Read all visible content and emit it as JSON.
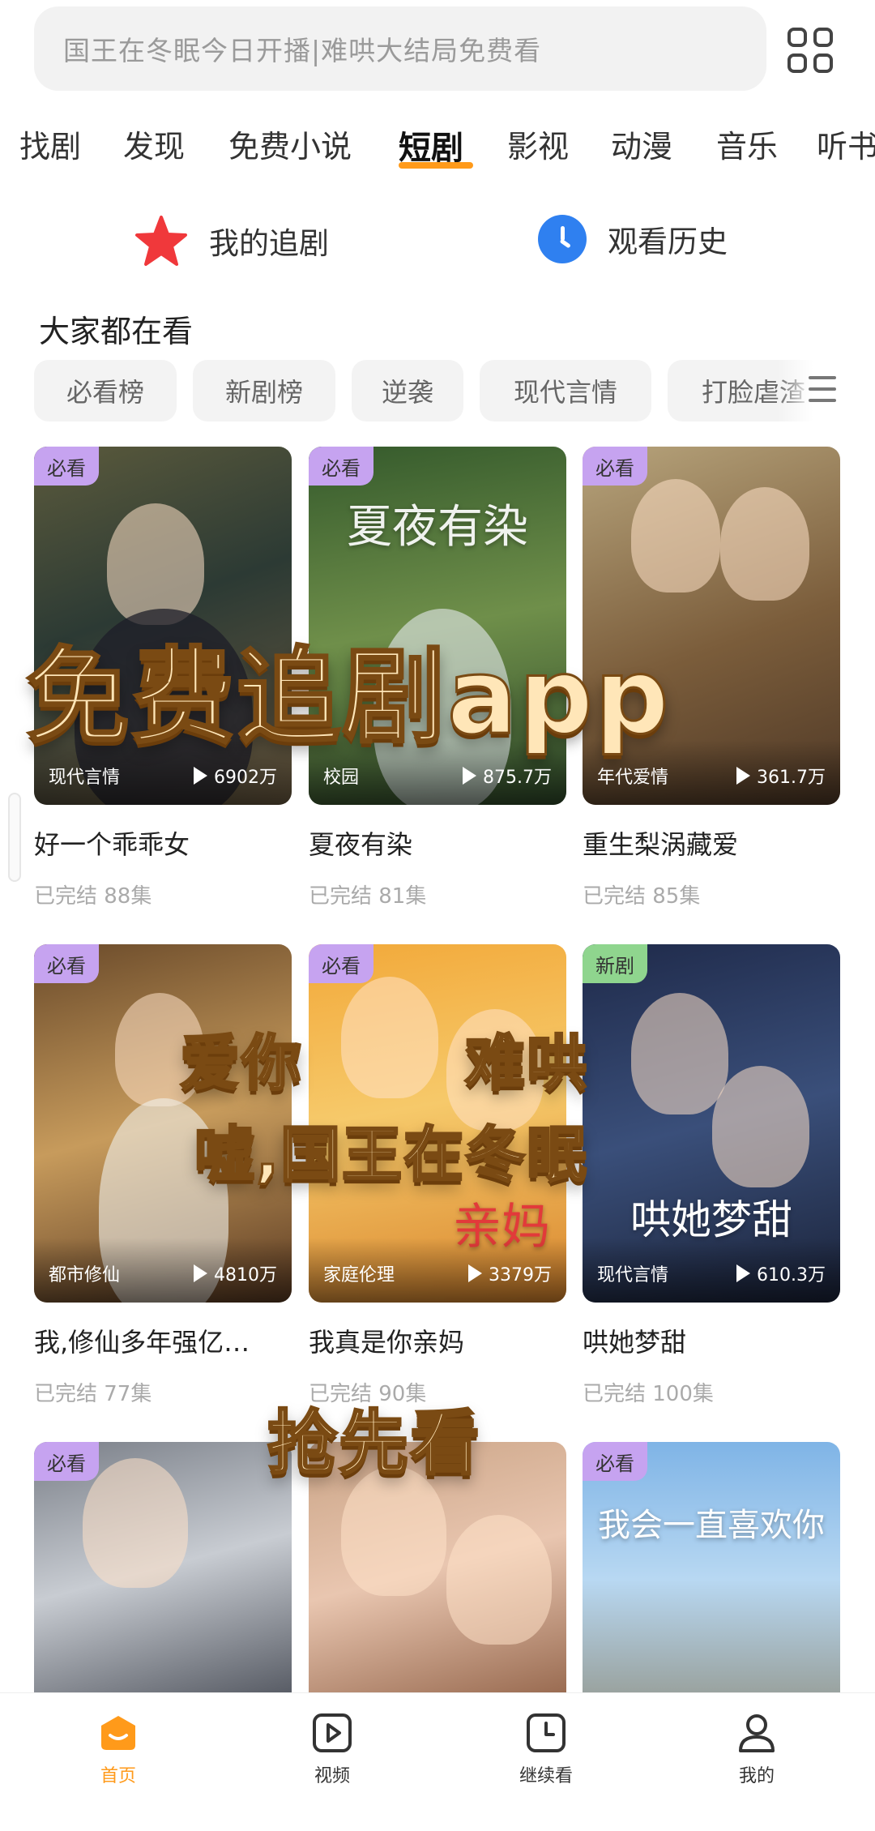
{
  "search": {
    "placeholder": "国王在冬眠今日开播|难哄大结局免费看"
  },
  "tabs": [
    "找剧",
    "发现",
    "免费小说",
    "短剧",
    "影视",
    "动漫",
    "音乐",
    "听书"
  ],
  "active_tab": "短剧",
  "quick_links": {
    "follow": "我的追剧",
    "history": "观看历史"
  },
  "section": {
    "title": "大家都在看"
  },
  "chips": [
    "必看榜",
    "新剧榜",
    "逆袭",
    "现代言情",
    "打脸虐渣"
  ],
  "cards": [
    {
      "badge": "必看",
      "genre": "现代言情",
      "views": "6902万",
      "title": "好一个乖乖女",
      "status": "已完结 88集",
      "poster_text": ""
    },
    {
      "badge": "必看",
      "genre": "校园",
      "views": "875.7万",
      "title": "夏夜有染",
      "status": "已完结 81集",
      "poster_text": "夏夜有染"
    },
    {
      "badge": "必看",
      "genre": "年代爱情",
      "views": "361.7万",
      "title": "重生梨涡藏爱",
      "status": "已完结 85集",
      "poster_text": ""
    },
    {
      "badge": "必看",
      "genre": "都市修仙",
      "views": "4810万",
      "title": "我,修仙多年强亿…",
      "status": "已完结 77集",
      "poster_text": ""
    },
    {
      "badge": "必看",
      "genre": "家庭伦理",
      "views": "3379万",
      "title": "我真是你亲妈",
      "status": "已完结 90集",
      "poster_text": "亲妈"
    },
    {
      "badge": "新剧",
      "genre": "现代言情",
      "views": "610.3万",
      "title": "哄她梦甜",
      "status": "已完结 100集",
      "poster_text": "哄她梦甜"
    },
    {
      "badge": "必看",
      "genre": "",
      "views": "",
      "title": "",
      "status": "",
      "poster_text": ""
    },
    {
      "badge": "",
      "genre": "",
      "views": "",
      "title": "",
      "status": "",
      "poster_text": ""
    },
    {
      "badge": "必看",
      "genre": "",
      "views": "",
      "title": "",
      "status": "",
      "poster_text": "我会一直喜欢你"
    }
  ],
  "promo": {
    "line1": "免费追剧app",
    "line2a": "爱你",
    "line2b": "难哄",
    "line3": "嘘,国王在冬眠",
    "line4": "抢先看"
  },
  "bottom_nav": {
    "home": "首页",
    "video": "视频",
    "continue": "继续看",
    "mine": "我的"
  },
  "colors": {
    "accent": "#ff9a1a",
    "badge_must": "#c6a3f0",
    "badge_new": "#8fd58e",
    "history_blue": "#2f80f0",
    "star_red": "#f0383b"
  }
}
